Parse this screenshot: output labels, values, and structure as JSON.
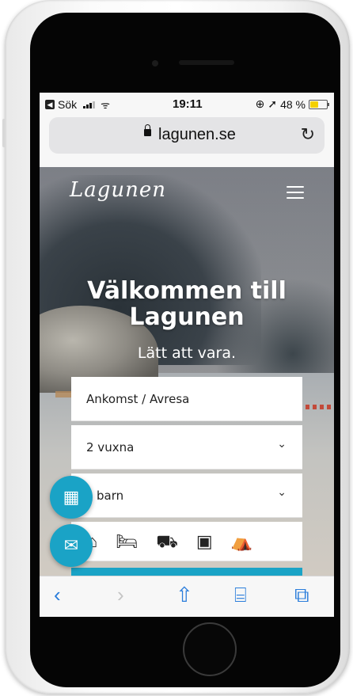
{
  "status_bar": {
    "back_app": "Sök",
    "time": "19:11",
    "battery_percent": "48 %",
    "battery_level": 0.48
  },
  "browser": {
    "url": "lagunen.se"
  },
  "site": {
    "logo": "Lagunen",
    "hero_title_line1": "Välkommen till",
    "hero_title_line2": "Lagunen",
    "hero_subtitle": "Lätt att vara.",
    "booking": {
      "dates_placeholder": "Ankomst / Avresa",
      "adults_value": "2 vuxna",
      "children_value": "barn",
      "accommodation_types": [
        "cabin-icon",
        "bed-icon",
        "motorhome-icon",
        "caravan-icon",
        "tent-icon"
      ]
    },
    "accent_color": "#1aa3c6"
  },
  "toolbar": {
    "icons": [
      "back-icon",
      "forward-icon",
      "share-icon",
      "bookmarks-icon",
      "tabs-icon"
    ]
  }
}
